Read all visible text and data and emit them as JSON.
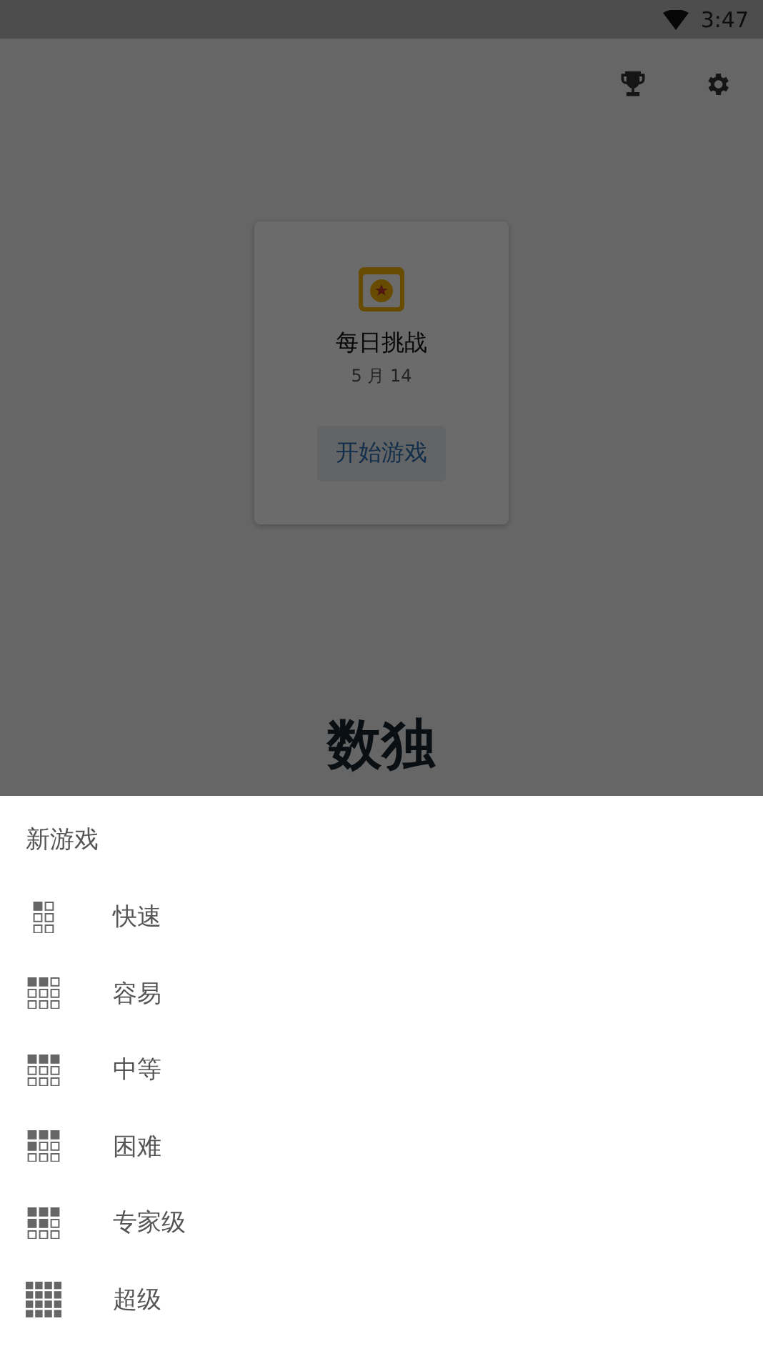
{
  "status_bar": {
    "time": "3:47"
  },
  "daily_challenge": {
    "title": "每日挑战",
    "date": "5 月 14",
    "button": "开始游戏"
  },
  "app_title": "数独",
  "new_game_sheet": {
    "title": "新游戏",
    "items": [
      {
        "label": "快速",
        "kind": "quick"
      },
      {
        "label": "容易",
        "kind": "easy"
      },
      {
        "label": "中等",
        "kind": "medium"
      },
      {
        "label": "困难",
        "kind": "hard"
      },
      {
        "label": "专家级",
        "kind": "expert"
      },
      {
        "label": "超级",
        "kind": "extreme"
      }
    ]
  }
}
